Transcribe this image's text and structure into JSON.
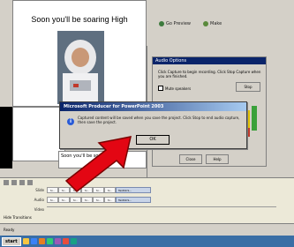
{
  "toolbar": {
    "button1": "Go Preview",
    "button2": "Make"
  },
  "slide": {
    "title": "Soon you'll be soaring High"
  },
  "notes": {
    "text": "Soon you'll be soa..."
  },
  "dialog_behind": {
    "title": "Audio Options",
    "text": "Click Capture to begin recording. Click Stop Capture when you are finished.",
    "check_label": "Mute speakers",
    "button_label": "Stop",
    "btn_a": "Close",
    "btn_b": "Help"
  },
  "msgbox": {
    "title": "Microsoft Producer for PowerPoint 2003",
    "text": "Captured content will be saved when you save the project. Click Stop to end audio capture, then save the project.",
    "ok_label": "OK"
  },
  "timeline": {
    "rows": [
      {
        "label": "Slide",
        "cells": [
          "Sl...",
          "Sl...",
          "Sl...",
          "Sl...",
          "Sl...",
          "Sl..."
        ],
        "block": "TextOnS..."
      },
      {
        "label": "Audio",
        "cells": [
          "Sl...",
          "Sl...",
          "Sl...",
          "Sl...",
          "Sl...",
          "Sl..."
        ],
        "block": "TextOnS..."
      },
      {
        "label": "Video",
        "cells": [],
        "block": ""
      }
    ],
    "footer": "Hide Transitions"
  },
  "status": {
    "text": "Ready"
  },
  "taskbar": {
    "start_label": "start"
  },
  "colors": {
    "accent": "#0a246a",
    "arrow": "#e30613"
  }
}
